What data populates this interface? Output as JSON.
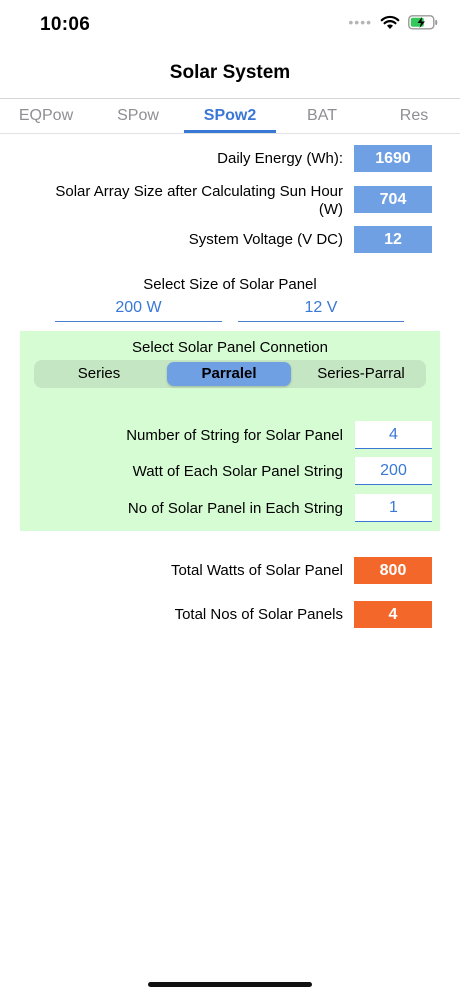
{
  "status": {
    "time": "10:06",
    "signal_icon": "signal-dots-icon",
    "wifi_icon": "wifi-icon",
    "battery_icon": "battery-charging-icon"
  },
  "nav": {
    "title": "Solar System"
  },
  "tabs": [
    {
      "label": "EQPow",
      "active": false
    },
    {
      "label": "SPow",
      "active": false
    },
    {
      "label": "SPow2",
      "active": true
    },
    {
      "label": "BAT",
      "active": false
    },
    {
      "label": "Res",
      "active": false
    }
  ],
  "summary": {
    "daily_energy_label": "Daily Energy (Wh):",
    "daily_energy_value": "1690",
    "array_size_label_line1": "Solar Array Size after Calculating Sun Hour",
    "array_size_label_line2": "(W)",
    "array_size_value": "704",
    "voltage_label": "System Voltage (V DC)",
    "voltage_value": "12"
  },
  "panel_select": {
    "title": "Select Size of Solar Panel",
    "watt_value": "200 W",
    "volt_value": "12 V"
  },
  "connection": {
    "title": "Select Solar Panel Connetion",
    "options": [
      "Series",
      "Parralel",
      "Series-Parral"
    ],
    "selected": "Parralel",
    "strings_label": "Number of String for Solar Panel",
    "strings_value": "4",
    "watt_string_label": "Watt of Each Solar Panel String",
    "watt_string_value": "200",
    "panels_per_string_label": "No of Solar Panel in Each String",
    "panels_per_string_value": "1"
  },
  "totals": {
    "watts_label": "Total Watts of Solar Panel",
    "watts_value": "800",
    "count_label": "Total Nos of Solar Panels",
    "count_value": "4"
  },
  "colors": {
    "accent_blue": "#3a78d6",
    "value_box_blue": "#6fa0e4",
    "result_orange": "#f4672a",
    "panel_green": "#d6fcd3",
    "battery_green": "#34c759"
  }
}
